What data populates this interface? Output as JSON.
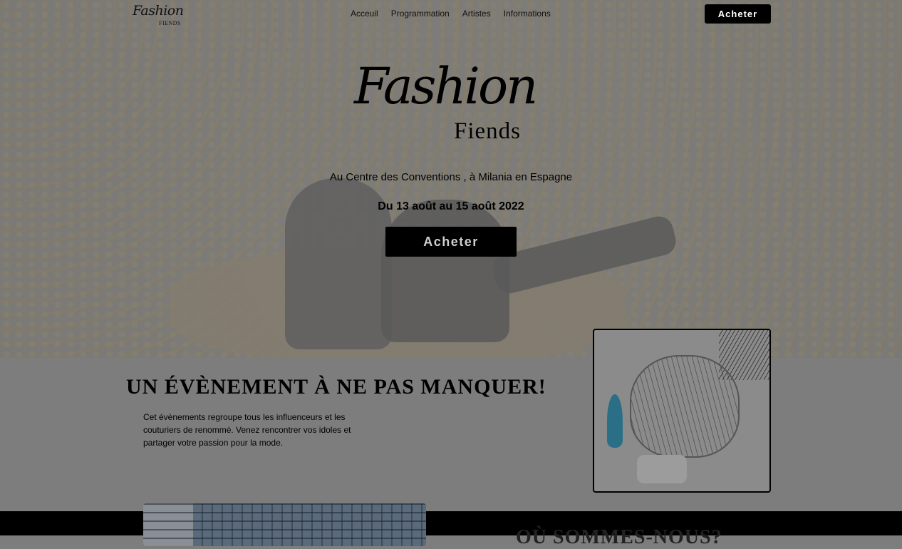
{
  "nav": {
    "logo_script": "Fashion",
    "logo_sub": "FIENDS",
    "links": [
      "Acceuil",
      "Programmation",
      "Artistes",
      "Informations"
    ],
    "cta": "Acheter"
  },
  "hero": {
    "logo_script": "Fashion",
    "logo_sub": "Fiends",
    "location": "Au Centre des Conventions , à Milania en Espagne",
    "dates": "Du 13 août au 15 août 2022",
    "cta": "Acheter"
  },
  "event": {
    "title": "UN ÉVÈNEMENT À NE PAS MANQUER!",
    "text": "Cet évènements regroupe tous les influenceurs et les couturiers de renommé. Venez rencontrer vos idoles et partager votre passion pour la mode."
  },
  "where": {
    "title": "OÙ SOMMES-NOUS?"
  }
}
